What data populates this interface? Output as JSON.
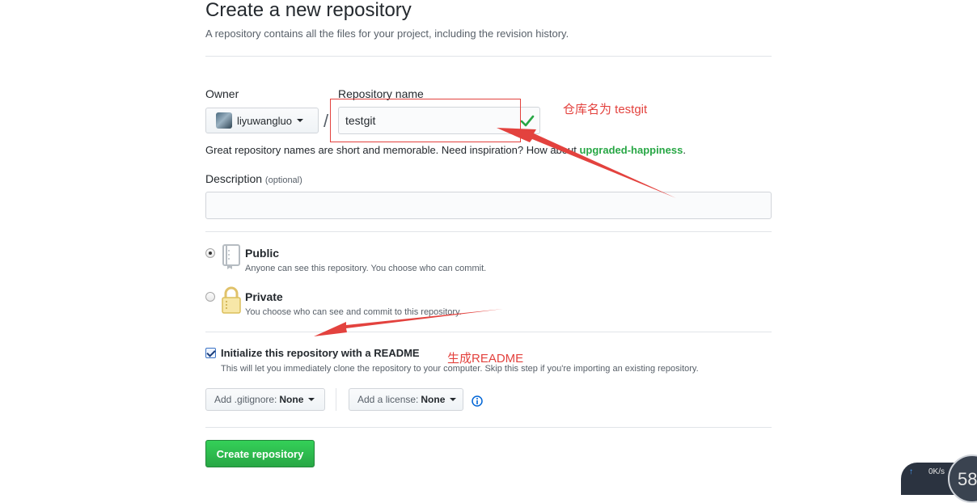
{
  "header": {
    "title": "Create a new repository",
    "subtitle": "A repository contains all the files for your project, including the revision history."
  },
  "owner": {
    "label": "Owner",
    "value": "liyuwangluo"
  },
  "repo": {
    "label": "Repository name",
    "value": "testgit",
    "separator": "/"
  },
  "hint": {
    "text": "Great repository names are short and memorable. Need inspiration? How about ",
    "suggestion": "upgraded-happiness",
    "end": "."
  },
  "description": {
    "label": "Description",
    "optional": "(optional)",
    "value": ""
  },
  "visibility": {
    "selected": "public",
    "public_title": "Public",
    "public_desc": "Anyone can see this repository. You choose who can commit.",
    "private_title": "Private",
    "private_desc": "You choose who can see and commit to this repository."
  },
  "readme": {
    "checked": true,
    "label": "Initialize this repository with a README",
    "desc": "This will let you immediately clone the repository to your computer. Skip this step if you're importing an existing repository."
  },
  "gitignore": {
    "label": "Add .gitignore:",
    "value": "None"
  },
  "license": {
    "label": "Add a license:",
    "value": "None"
  },
  "create_button": "Create repository",
  "annotations": {
    "repo_name_note": "仓库名为 testgit",
    "readme_note": "生成README",
    "color": "#e3423e"
  },
  "speed_widget": {
    "rate": "0K/s",
    "number": "58"
  },
  "colors": {
    "primary_button": "#28a745",
    "suggestion": "#28a745",
    "annotation": "#e3423e"
  }
}
